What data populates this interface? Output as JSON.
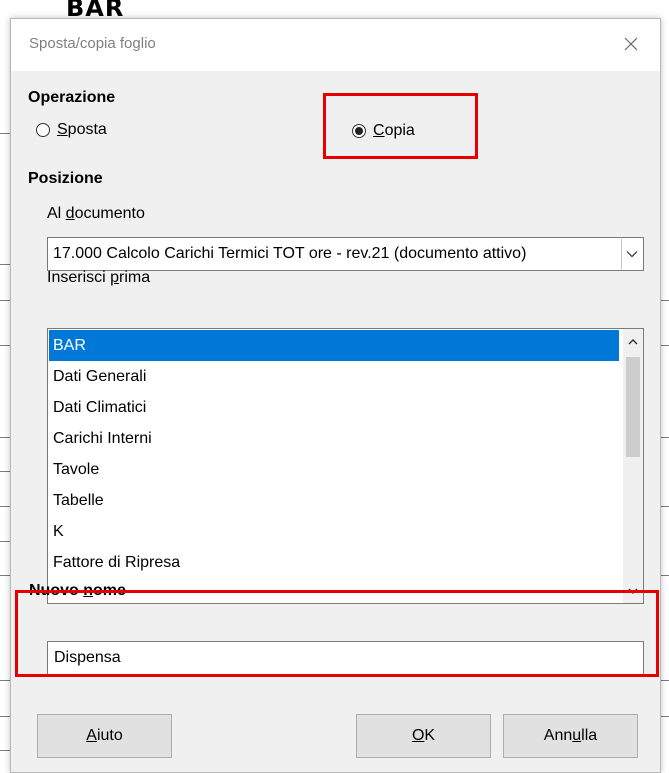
{
  "background": {
    "sheet_fragment": "BAR"
  },
  "dialog": {
    "title": "Sposta/copia foglio",
    "operation": {
      "label": "Operazione",
      "options": [
        {
          "label_prefix": "",
          "label_mnemonic": "S",
          "label_rest": "posta",
          "checked": false
        },
        {
          "label_prefix": "",
          "label_mnemonic": "C",
          "label_rest": "opia",
          "checked": true
        }
      ]
    },
    "position": {
      "label": "Posizione",
      "to_document": {
        "label_prefix": "Al ",
        "label_mnemonic": "d",
        "label_rest": "ocumento",
        "selected": "17.000 Calcolo Carichi Termici TOT ore - rev.21 (documento attivo)"
      },
      "insert_before": {
        "label_prefix": "Inserisci ",
        "label_mnemonic": "p",
        "label_rest": "rima",
        "items": [
          "BAR",
          "Dati Generali",
          "Dati Climatici",
          "Carichi Interni",
          "Tavole",
          "Tabelle",
          "K",
          "Fattore di Ripresa"
        ],
        "selected_index": 0
      }
    },
    "new_name": {
      "label_prefix": "Nuovo ",
      "label_mnemonic": "n",
      "label_rest": "ome",
      "value": "Dispensa"
    },
    "buttons": {
      "help": {
        "mnemonic": "A",
        "rest": "iuto"
      },
      "ok": {
        "mnemonic": "O",
        "rest": "K"
      },
      "cancel": {
        "prefix": "Ann",
        "mnemonic": "u",
        "rest": "lla"
      }
    }
  },
  "highlight_color": "#e60000",
  "selection_color": "#0078d7"
}
